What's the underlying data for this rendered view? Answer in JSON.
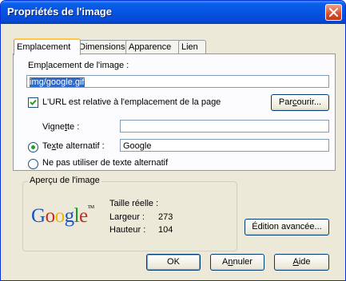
{
  "window": {
    "title": "Propriétés de l'image"
  },
  "tabs": [
    {
      "label": "Emplacement",
      "active": true
    },
    {
      "label": "Dimensions",
      "active": false
    },
    {
      "label": "Apparence",
      "active": false
    },
    {
      "label": "Lien",
      "active": false
    }
  ],
  "location": {
    "label": "Emplacement de l'image :",
    "value": "img/google.gif",
    "relative_checkbox_label": "L'URL est relative à l'emplacement de la page",
    "relative_checked": true,
    "browse_button": "Parcourir..."
  },
  "thumbnail": {
    "label": "Vignette :",
    "value": ""
  },
  "alt_text": {
    "radio_label": "Texte alternatif :",
    "value": "Google",
    "selected": true,
    "no_alt_label": "Ne pas utiliser de texte alternatif"
  },
  "preview": {
    "group_title": "Aperçu de l'image",
    "logo_text": "Google",
    "logo_tm": "TM",
    "actual_size_label": "Taille réelle :",
    "width_label": "Largeur :",
    "width_value": "273",
    "height_label": "Hauteur :",
    "height_value": "104",
    "logo_colors": [
      "#1a54c6",
      "#cc2a1f",
      "#e8b50b",
      "#1a54c6",
      "#1a8f2e",
      "#cc2a1f"
    ]
  },
  "buttons": {
    "advanced": "Édition avancée...",
    "ok": "OK",
    "cancel": "Annuler",
    "help": "Aide"
  },
  "icons": {
    "close": "close-icon",
    "check": "check-icon"
  }
}
